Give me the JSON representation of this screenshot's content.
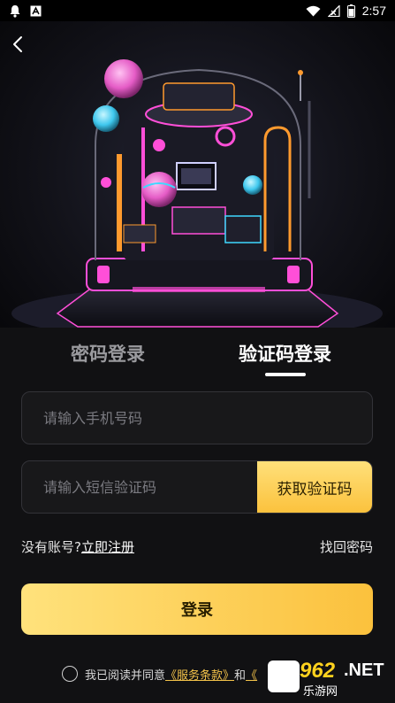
{
  "status_bar": {
    "time": "2:57",
    "icons": [
      "notification-bell-icon",
      "app-a-icon",
      "wifi-icon",
      "signal-icon",
      "battery-icon"
    ]
  },
  "header": {
    "back_icon": "chevron-left-icon"
  },
  "tabs": [
    {
      "label": "密码登录",
      "active": false
    },
    {
      "label": "验证码登录",
      "active": true
    }
  ],
  "form": {
    "phone_placeholder": "请输入手机号码",
    "code_placeholder": "请输入短信验证码",
    "get_code_label": "获取验证码"
  },
  "links": {
    "no_account": "没有账号?",
    "register": "立即注册",
    "forgot": "找回密码"
  },
  "login_button": "登录",
  "agreement": {
    "prefix": "我已阅读并同意",
    "terms": "《服务条款》",
    "and": "和",
    "privacy_visible": "《"
  },
  "watermark": {
    "number": "962",
    "net": ".NET",
    "sub": "乐游网"
  },
  "colors": {
    "accent_yellow": "#fbc23d",
    "background": "#111113",
    "neon_pink": "#ff4fd8",
    "neon_cyan": "#3fd8ff",
    "neon_orange": "#ff9a2e"
  }
}
